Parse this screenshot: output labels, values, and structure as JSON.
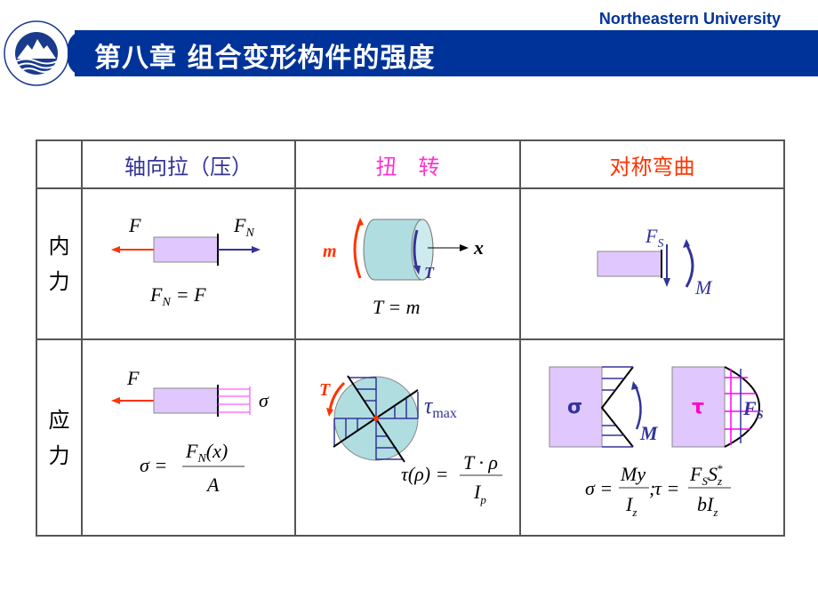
{
  "header": {
    "brand": "Northeastern University",
    "chapter_title": "第八章  组合变形构件的强度",
    "logo": "university-seal-icon",
    "colors": {
      "title_bar": "#003399",
      "brand_text": "#003399"
    }
  },
  "table": {
    "columns": [
      {
        "label": "轴向拉（压）",
        "color": "#333399"
      },
      {
        "label": "扭　转",
        "color": "#ff33cc"
      },
      {
        "label": "对称弯曲",
        "color": "#ff3300"
      }
    ],
    "rows": [
      {
        "label": "内力",
        "label_chars": [
          "内",
          "力"
        ],
        "cells": {
          "axial": {
            "force_left": "F",
            "force_right": "F",
            "force_right_sub": "N",
            "formula_lhs": "F",
            "formula_lhs_sub": "N",
            "formula_rhs": "= F"
          },
          "torsion": {
            "moment_label": "m",
            "torque_label": "T",
            "axis_label": "x",
            "formula": "T = m"
          },
          "bending": {
            "shear_label": "F",
            "shear_sub": "S",
            "moment_label": "M"
          }
        }
      },
      {
        "label": "应力",
        "label_chars": [
          "应",
          "力"
        ],
        "cells": {
          "axial": {
            "force_left": "F",
            "stress_label": "σ",
            "formula_lhs": "σ =",
            "num": "F",
            "num_sub": "N",
            "num_tail": "(x)",
            "den": "A"
          },
          "torsion": {
            "torque_label": "T",
            "tau_label": "τ",
            "tau_sub": "max",
            "formula_lhs": "τ(ρ) =",
            "num": "T · ρ",
            "den": "I",
            "den_sub": "p"
          },
          "bending": {
            "sigma_block": "σ",
            "tau_block": "τ",
            "moment_label": "M",
            "shear_label": "F",
            "shear_sub": "S",
            "f1_lhs": "σ =",
            "f1_num": "My",
            "f1_den": "I",
            "f1_den_sub": "z",
            "sep": ";",
            "f2_lhs": "τ =",
            "f2_num_a": "F",
            "f2_num_a_sub": "S",
            "f2_num_b": "S",
            "f2_num_b_sub": "z",
            "f2_num_b_sup": "*",
            "f2_den": "bI",
            "f2_den_sub": "z"
          }
        }
      }
    ]
  }
}
